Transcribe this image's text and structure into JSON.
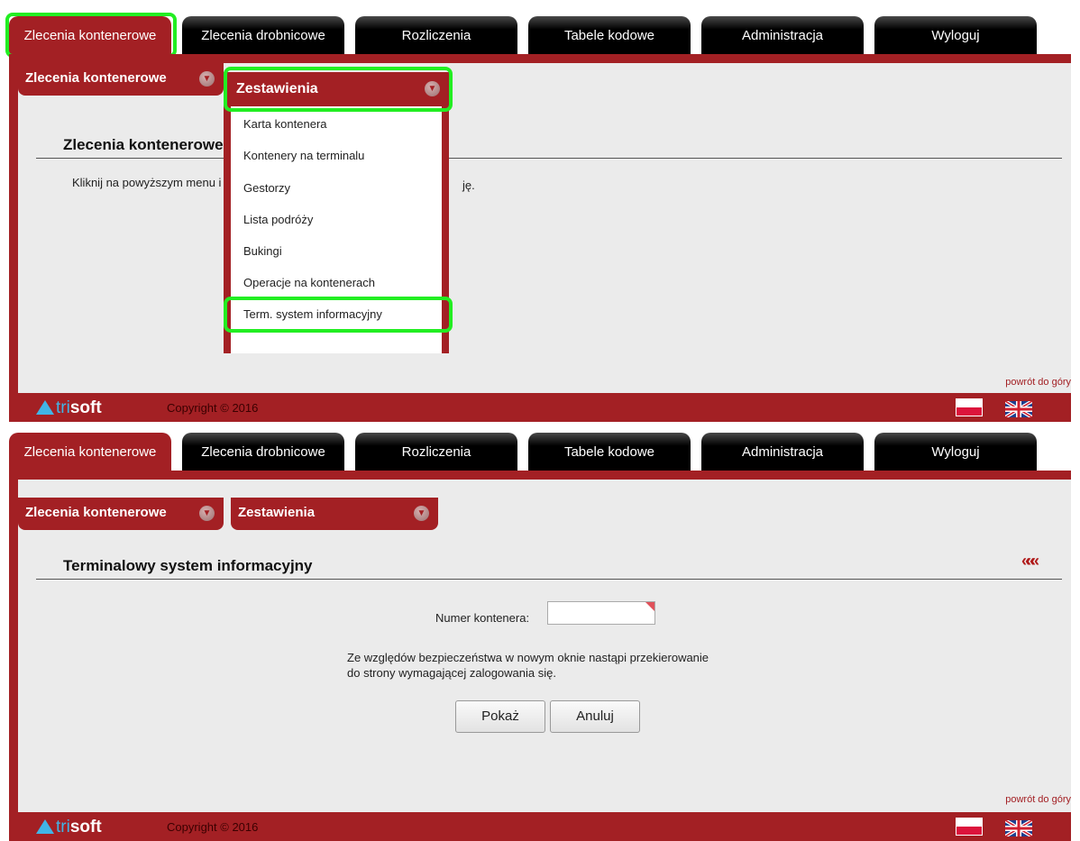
{
  "nav": {
    "tabs": [
      {
        "label": "Zlecenia kontenerowe"
      },
      {
        "label": "Zlecenia drobnicowe"
      },
      {
        "label": "Rozliczenia"
      },
      {
        "label": "Tabele kodowe"
      },
      {
        "label": "Administracja"
      },
      {
        "label": "Wyloguj"
      }
    ]
  },
  "top": {
    "subtabs": {
      "primary": "Zlecenia kontenerowe",
      "secondary": "Zestawienia"
    },
    "section_title": "Zlecenia kontenerowe",
    "hint_left": "Kliknij na powyższym menu i",
    "hint_right": "ję.",
    "dropdown": {
      "items": [
        {
          "label": "Karta kontenera"
        },
        {
          "label": "Kontenery na terminalu"
        },
        {
          "label": "Gestorzy"
        },
        {
          "label": "Lista podróży"
        },
        {
          "label": "Bukingi"
        },
        {
          "label": "Operacje na kontenerach"
        },
        {
          "label": "Term. system informacyjny"
        }
      ]
    }
  },
  "bottom": {
    "subtabs": {
      "primary": "Zlecenia kontenerowe",
      "secondary": "Zestawienia"
    },
    "back_label": "«««",
    "section_title": "Terminalowy system informacyjny",
    "container_label": "Numer kontenera:",
    "container_value": "",
    "note_line1": "Ze względów bezpieczeństwa w nowym oknie nastąpi przekierowanie",
    "note_line2": "do strony wymagającej zalogowania się.",
    "show_button": "Pokaż",
    "cancel_button": "Anuluj"
  },
  "footer": {
    "to_top": "powrót do góry",
    "logo_tri": "tri",
    "logo_soft": "soft",
    "copyright": "Copyright © 2016"
  },
  "colors": {
    "accent": "#a32024",
    "highlight": "#22ee22",
    "nav_bg": "#000000",
    "logo_blue": "#41b4e6"
  }
}
